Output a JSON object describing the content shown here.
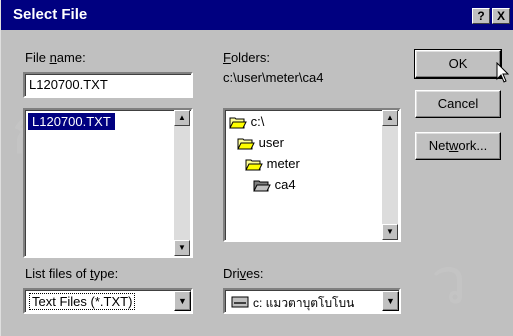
{
  "window": {
    "title": "Select File",
    "help_glyph": "?",
    "close_glyph": "X"
  },
  "file_name": {
    "label_pre": "File ",
    "label_u": "n",
    "label_post": "ame:",
    "value": "L120700.TXT",
    "list": [
      "L120700.TXT"
    ]
  },
  "folders": {
    "label_pre": "",
    "label_u": "F",
    "label_post": "olders:",
    "path": "c:\\user\\meter\\ca4",
    "tree": [
      "c:\\",
      "user",
      "meter",
      "ca4"
    ]
  },
  "buttons": {
    "ok": "OK",
    "cancel": "Cancel",
    "network_pre": "Net",
    "network_u": "w",
    "network_post": "ork..."
  },
  "file_types": {
    "label_pre": "List files of ",
    "label_u": "t",
    "label_post": "ype:",
    "selected": "Text Files (*.TXT)"
  },
  "drives": {
    "label_pre": "Dri",
    "label_u": "v",
    "label_post": "es:",
    "selected": "c: แมวตาบุตโบโบน"
  },
  "colors": {
    "title_bar": "#000080",
    "face": "#c0c0c0",
    "selection": "#000080"
  }
}
